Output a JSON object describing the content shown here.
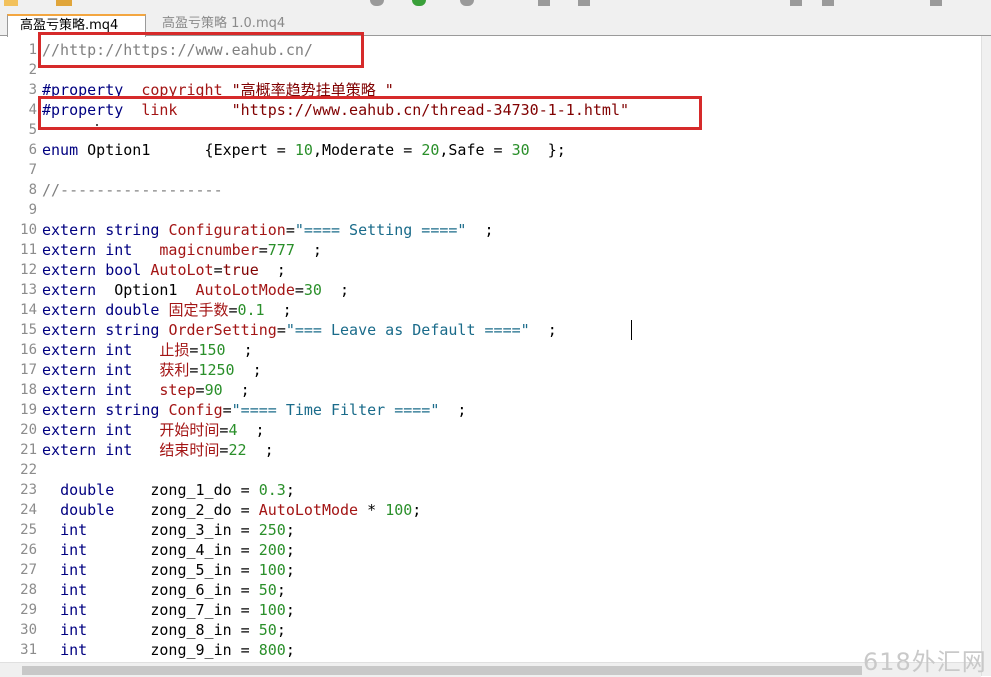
{
  "tabs": [
    {
      "label": "高盈亏策略.mq4",
      "active": true
    },
    {
      "label": "高盈亏策略 1.0.mq4",
      "active": false
    }
  ],
  "lines": [
    {
      "n": "1",
      "tokens": [
        [
          "cm",
          "//http://https://www.eahub.cn/"
        ]
      ]
    },
    {
      "n": "2",
      "tokens": []
    },
    {
      "n": "3",
      "tokens": [
        [
          "pp",
          "#property"
        ],
        [
          "pl",
          "  "
        ],
        [
          "var",
          "copyright"
        ],
        [
          "pl",
          " "
        ],
        [
          "strb",
          "\"高概率趋势挂单策略 \""
        ]
      ]
    },
    {
      "n": "4",
      "tokens": [
        [
          "pp",
          "#property"
        ],
        [
          "pl",
          "  "
        ],
        [
          "var",
          "link"
        ],
        [
          "pl",
          "      "
        ],
        [
          "strb",
          "\"https://www.eahub.cn/thread-34730-1-1.html\""
        ]
      ]
    },
    {
      "n": "5",
      "tokens": []
    },
    {
      "n": "6",
      "tokens": [
        [
          "kw",
          "enum"
        ],
        [
          "pl",
          " Option1      {Expert = "
        ],
        [
          "num",
          "10"
        ],
        [
          "pl",
          ",Moderate = "
        ],
        [
          "num",
          "20"
        ],
        [
          "pl",
          ",Safe = "
        ],
        [
          "num",
          "30"
        ],
        [
          "pl",
          "  };"
        ]
      ]
    },
    {
      "n": "7",
      "tokens": []
    },
    {
      "n": "8",
      "tokens": [
        [
          "cm",
          "//------------------"
        ]
      ]
    },
    {
      "n": "9",
      "tokens": []
    },
    {
      "n": "10",
      "tokens": [
        [
          "kw",
          "extern"
        ],
        [
          "pl",
          " "
        ],
        [
          "kw",
          "string"
        ],
        [
          "pl",
          " "
        ],
        [
          "var",
          "Configuration"
        ],
        [
          "pl",
          "="
        ],
        [
          "str",
          "\"==== Setting ====\""
        ],
        [
          "pl",
          "  ;"
        ]
      ]
    },
    {
      "n": "11",
      "tokens": [
        [
          "kw",
          "extern"
        ],
        [
          "pl",
          " "
        ],
        [
          "kw",
          "int"
        ],
        [
          "pl",
          "   "
        ],
        [
          "var",
          "magicnumber"
        ],
        [
          "pl",
          "="
        ],
        [
          "num",
          "777"
        ],
        [
          "pl",
          "  ;"
        ]
      ]
    },
    {
      "n": "12",
      "tokens": [
        [
          "kw",
          "extern"
        ],
        [
          "pl",
          " "
        ],
        [
          "kw",
          "bool"
        ],
        [
          "pl",
          " "
        ],
        [
          "var",
          "AutoLot"
        ],
        [
          "pl",
          "="
        ],
        [
          "strb",
          "true"
        ],
        [
          "pl",
          "  ;"
        ]
      ]
    },
    {
      "n": "13",
      "tokens": [
        [
          "kw",
          "extern"
        ],
        [
          "pl",
          "  Option1  "
        ],
        [
          "var",
          "AutoLotMode"
        ],
        [
          "pl",
          "="
        ],
        [
          "num",
          "30"
        ],
        [
          "pl",
          "  ;"
        ]
      ]
    },
    {
      "n": "14",
      "tokens": [
        [
          "kw",
          "extern"
        ],
        [
          "pl",
          " "
        ],
        [
          "kw",
          "double"
        ],
        [
          "pl",
          " "
        ],
        [
          "var",
          "固定手数"
        ],
        [
          "pl",
          "="
        ],
        [
          "num",
          "0.1"
        ],
        [
          "pl",
          "  ;"
        ]
      ]
    },
    {
      "n": "15",
      "tokens": [
        [
          "kw",
          "extern"
        ],
        [
          "pl",
          " "
        ],
        [
          "kw",
          "string"
        ],
        [
          "pl",
          " "
        ],
        [
          "var",
          "OrderSetting"
        ],
        [
          "pl",
          "="
        ],
        [
          "str",
          "\"=== Leave as Default ====\""
        ],
        [
          "pl",
          "  ;"
        ]
      ]
    },
    {
      "n": "16",
      "tokens": [
        [
          "kw",
          "extern"
        ],
        [
          "pl",
          " "
        ],
        [
          "kw",
          "int"
        ],
        [
          "pl",
          "   "
        ],
        [
          "var",
          "止损"
        ],
        [
          "pl",
          "="
        ],
        [
          "num",
          "150"
        ],
        [
          "pl",
          "  ;"
        ]
      ]
    },
    {
      "n": "17",
      "tokens": [
        [
          "kw",
          "extern"
        ],
        [
          "pl",
          " "
        ],
        [
          "kw",
          "int"
        ],
        [
          "pl",
          "   "
        ],
        [
          "var",
          "获利"
        ],
        [
          "pl",
          "="
        ],
        [
          "num",
          "1250"
        ],
        [
          "pl",
          "  ;"
        ]
      ]
    },
    {
      "n": "18",
      "tokens": [
        [
          "kw",
          "extern"
        ],
        [
          "pl",
          " "
        ],
        [
          "kw",
          "int"
        ],
        [
          "pl",
          "   "
        ],
        [
          "var",
          "step"
        ],
        [
          "pl",
          "="
        ],
        [
          "num",
          "90"
        ],
        [
          "pl",
          "  ;"
        ]
      ]
    },
    {
      "n": "19",
      "tokens": [
        [
          "kw",
          "extern"
        ],
        [
          "pl",
          " "
        ],
        [
          "kw",
          "string"
        ],
        [
          "pl",
          " "
        ],
        [
          "var",
          "Config"
        ],
        [
          "pl",
          "="
        ],
        [
          "str",
          "\"==== Time Filter ====\""
        ],
        [
          "pl",
          "  ;"
        ]
      ]
    },
    {
      "n": "20",
      "tokens": [
        [
          "kw",
          "extern"
        ],
        [
          "pl",
          " "
        ],
        [
          "kw",
          "int"
        ],
        [
          "pl",
          "   "
        ],
        [
          "var",
          "开始时间"
        ],
        [
          "pl",
          "="
        ],
        [
          "num",
          "4"
        ],
        [
          "pl",
          "  ;"
        ]
      ]
    },
    {
      "n": "21",
      "tokens": [
        [
          "kw",
          "extern"
        ],
        [
          "pl",
          " "
        ],
        [
          "kw",
          "int"
        ],
        [
          "pl",
          "   "
        ],
        [
          "var",
          "结束时间"
        ],
        [
          "pl",
          "="
        ],
        [
          "num",
          "22"
        ],
        [
          "pl",
          "  ;"
        ]
      ]
    },
    {
      "n": "22",
      "tokens": []
    },
    {
      "n": "23",
      "tokens": [
        [
          "pl",
          "  "
        ],
        [
          "kw",
          "double"
        ],
        [
          "pl",
          "    zong_1_do = "
        ],
        [
          "num",
          "0.3"
        ],
        [
          "pl",
          ";"
        ]
      ]
    },
    {
      "n": "24",
      "tokens": [
        [
          "pl",
          "  "
        ],
        [
          "kw",
          "double"
        ],
        [
          "pl",
          "    zong_2_do = "
        ],
        [
          "var",
          "AutoLotMode"
        ],
        [
          "pl",
          " * "
        ],
        [
          "num",
          "100"
        ],
        [
          "pl",
          ";"
        ]
      ]
    },
    {
      "n": "25",
      "tokens": [
        [
          "pl",
          "  "
        ],
        [
          "kw",
          "int"
        ],
        [
          "pl",
          "       zong_3_in = "
        ],
        [
          "num",
          "250"
        ],
        [
          "pl",
          ";"
        ]
      ]
    },
    {
      "n": "26",
      "tokens": [
        [
          "pl",
          "  "
        ],
        [
          "kw",
          "int"
        ],
        [
          "pl",
          "       zong_4_in = "
        ],
        [
          "num",
          "200"
        ],
        [
          "pl",
          ";"
        ]
      ]
    },
    {
      "n": "27",
      "tokens": [
        [
          "pl",
          "  "
        ],
        [
          "kw",
          "int"
        ],
        [
          "pl",
          "       zong_5_in = "
        ],
        [
          "num",
          "100"
        ],
        [
          "pl",
          ";"
        ]
      ]
    },
    {
      "n": "28",
      "tokens": [
        [
          "pl",
          "  "
        ],
        [
          "kw",
          "int"
        ],
        [
          "pl",
          "       zong_6_in = "
        ],
        [
          "num",
          "50"
        ],
        [
          "pl",
          ";"
        ]
      ]
    },
    {
      "n": "29",
      "tokens": [
        [
          "pl",
          "  "
        ],
        [
          "kw",
          "int"
        ],
        [
          "pl",
          "       zong_7_in = "
        ],
        [
          "num",
          "100"
        ],
        [
          "pl",
          ";"
        ]
      ]
    },
    {
      "n": "30",
      "tokens": [
        [
          "pl",
          "  "
        ],
        [
          "kw",
          "int"
        ],
        [
          "pl",
          "       zong_8_in = "
        ],
        [
          "num",
          "50"
        ],
        [
          "pl",
          ";"
        ]
      ]
    },
    {
      "n": "31",
      "tokens": [
        [
          "pl",
          "  "
        ],
        [
          "kw",
          "int"
        ],
        [
          "pl",
          "       zong_9_in = "
        ],
        [
          "num",
          "800"
        ],
        [
          "pl",
          ";"
        ]
      ]
    }
  ],
  "watermark": "618外汇网",
  "colors": {
    "highlight_box": "#d62a2a",
    "active_tab_accent": "#f3a640"
  }
}
